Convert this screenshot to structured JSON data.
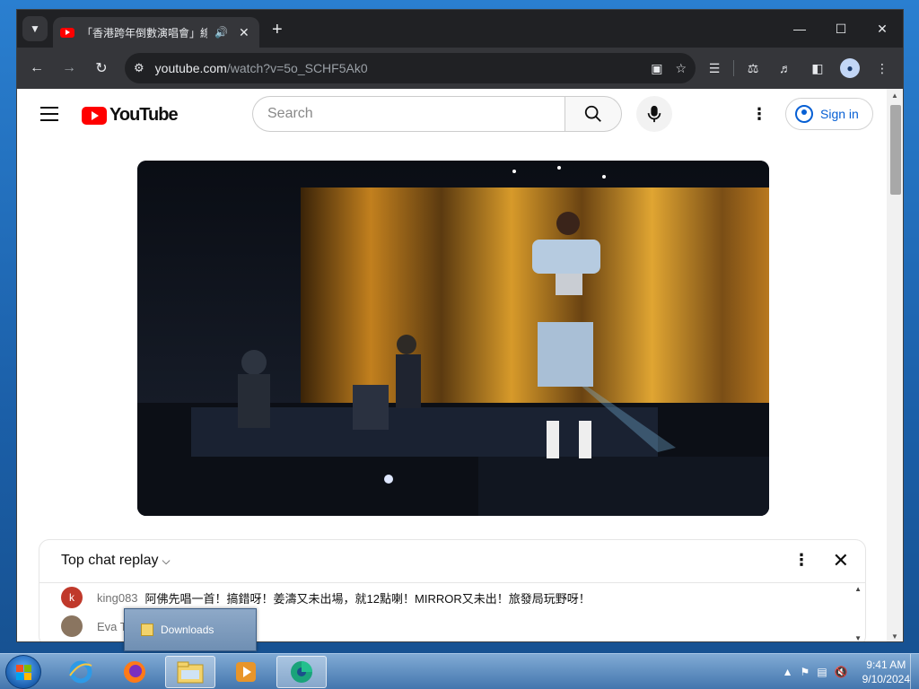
{
  "browser": {
    "tab_title": "「香港跨年倒數演唱會」線上",
    "address_host": "youtube.com",
    "address_path": "/watch?v=5o_SCHF5Ak0"
  },
  "youtube": {
    "logo_text": "YouTube",
    "search_placeholder": "Search",
    "signin_label": "Sign in"
  },
  "chat": {
    "title": "Top chat replay",
    "messages": [
      {
        "avatar_letter": "k",
        "avatar_color": "#c0392b",
        "author": "king083",
        "text": "阿佛先唱一首！搞錯呀！姜濤又未出場，就12點喇！MIRROR又未出！旅發局玩野呀！"
      },
      {
        "avatar_letter": "",
        "avatar_color": "#8a7560",
        "author": "Eva T",
        "text": ""
      }
    ]
  },
  "taskbar": {
    "popup_label": "Downloads",
    "time": "9:41 AM",
    "date": "9/10/2024"
  }
}
